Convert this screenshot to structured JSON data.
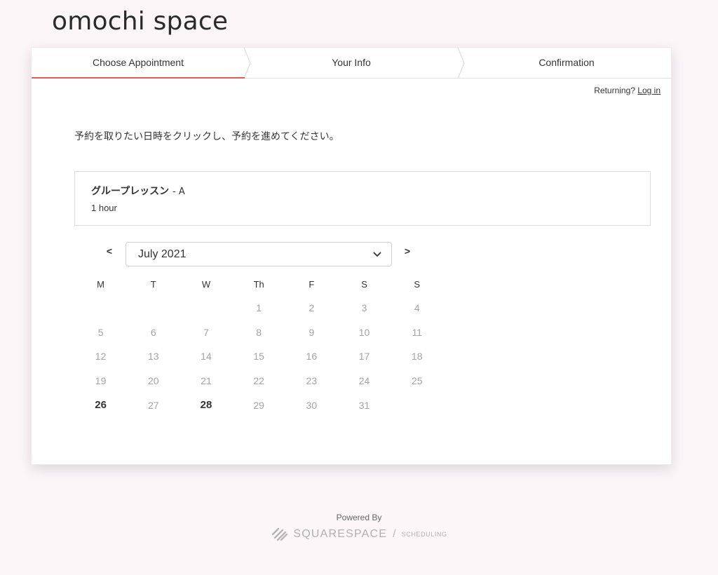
{
  "site": {
    "title": "omochi space"
  },
  "steps": [
    {
      "label": "Choose Appointment",
      "active": true
    },
    {
      "label": "Your Info",
      "active": false
    },
    {
      "label": "Confirmation",
      "active": false
    }
  ],
  "returning": {
    "prefix": "Returning?",
    "login_label": "Log in"
  },
  "instruction": "予約を取りたい日時をクリックし、予約を進めてください。",
  "appointment": {
    "name": "グループレッスン",
    "calendar": "- A",
    "duration": "1 hour"
  },
  "calendar_nav": {
    "prev_label": "<",
    "next_label": ">",
    "selected_month": "July 2021"
  },
  "weekdays": [
    "M",
    "T",
    "W",
    "Th",
    "F",
    "S",
    "S"
  ],
  "weeks": [
    [
      "",
      "",
      "",
      "1",
      "2",
      "3",
      "4"
    ],
    [
      "5",
      "6",
      "7",
      "8",
      "9",
      "10",
      "11"
    ],
    [
      "12",
      "13",
      "14",
      "15",
      "16",
      "17",
      "18"
    ],
    [
      "19",
      "20",
      "21",
      "22",
      "23",
      "24",
      "25"
    ],
    [
      "26",
      "27",
      "28",
      "29",
      "30",
      "31",
      ""
    ]
  ],
  "available_days": [
    "26",
    "28"
  ],
  "footer": {
    "powered_by": "Powered By",
    "brand": "SQUARESPACE",
    "separator": "/",
    "product": "SCHEDULING"
  },
  "colors": {
    "accent": "#e25c5c",
    "page_bg": "#fcf6f9"
  }
}
